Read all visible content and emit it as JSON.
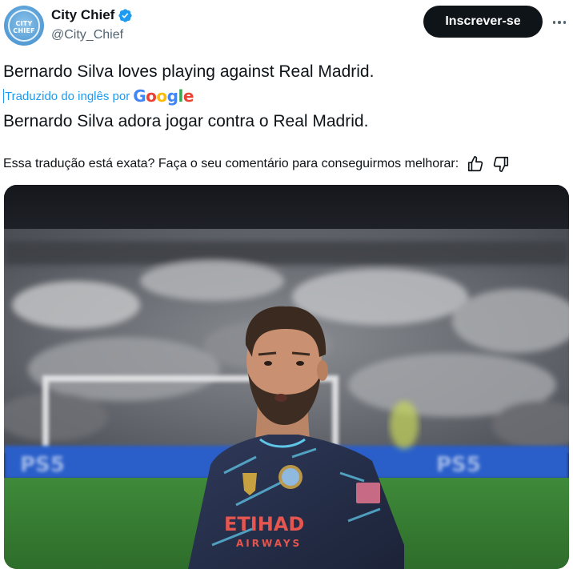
{
  "account": {
    "display_name": "City Chief",
    "handle": "@City_Chief",
    "verified": true,
    "avatar_text": "CITY CHIEF",
    "avatar_icon": "city-chief-logo"
  },
  "actions": {
    "subscribe_label": "Inscrever-se",
    "more_icon": "ellipsis-icon"
  },
  "tweet": {
    "original_text": "Bernardo Silva loves playing against Real Madrid.",
    "translated_by": "Traduzido do inglês por",
    "translator_brand": [
      "G",
      "o",
      "o",
      "g",
      "l",
      "e"
    ],
    "translated_text": "Bernardo Silva adora jogar contra o Real Madrid."
  },
  "feedback": {
    "prompt": "Essa tradução está exata? Faça o seu comentário para conseguirmos melhorar:",
    "thumbs_up_icon": "thumbs-up-icon",
    "thumbs_down_icon": "thumbs-down-icon"
  },
  "media": {
    "jersey_sponsor": "ETIHAD",
    "jersey_sponsor_sub": "AIRWAYS",
    "board_text": "PS5"
  },
  "colors": {
    "accent": "#1d9bf0",
    "button_bg": "#0f1419",
    "secondary_text": "#536471"
  }
}
